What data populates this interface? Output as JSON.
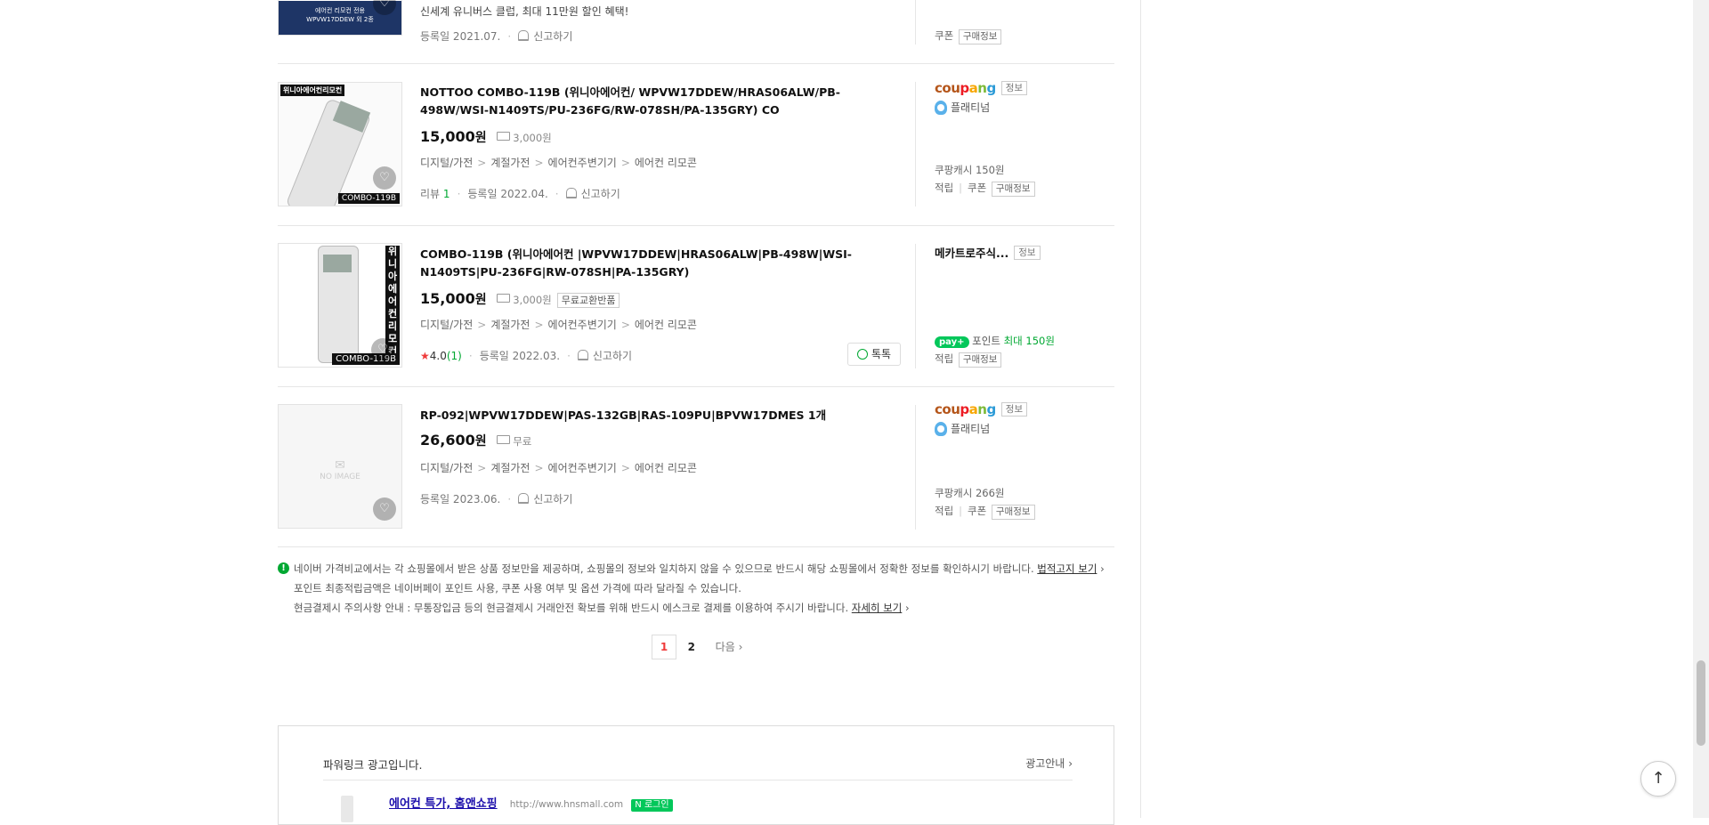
{
  "products": [
    {
      "image_text": [
        "에어컨 리모컨 전용",
        "WPVW17DDEW 외 2종"
      ],
      "promo": "신세계 유니버스 클럽, 최대 11만원 할인 혜택!",
      "reg_date": "등록일 2021.07.",
      "report": "신고하기",
      "seller_line": [
        "쿠폰",
        "구매정보"
      ]
    },
    {
      "image_label": "위니아에어컨리모컨",
      "image_model": "COMBO-119B",
      "title": "NOTTOO COMBO-119B (위니아에어컨/ WPVW17DDEW/HRAS06ALW/PB-498W/WSI-N1409TS/PU-236FG/RW-078SH/PA-135GRY) CO",
      "price": "15,000",
      "won": "원",
      "shipping": "3,000원",
      "categories": [
        "디지털/가전",
        "계절가전",
        "에어컨주변기기",
        "에어컨 리모콘"
      ],
      "review_label": "리뷰",
      "review_count": "1",
      "reg_date": "등록일 2022.04.",
      "report": "신고하기",
      "seller": {
        "logo": [
          "cou",
          "p",
          "a",
          "n",
          "g"
        ],
        "info": "정보",
        "grade": "플래티넘",
        "cash": "쿠팡캐시 150원",
        "tags": [
          "적립",
          "쿠폰"
        ],
        "buy_info": "구매정보"
      }
    },
    {
      "image_label": "위니아에어컨리모컨",
      "image_model": "COMBO-119B",
      "title": "COMBO-119B (위니아에어컨 |WPVW17DDEW|HRAS06ALW|PB-498W|WSI-N1409TS|PU-236FG|RW-078SH|PA-135GRY)",
      "price": "15,000",
      "won": "원",
      "shipping": "3,000원",
      "badge": "무료교환반품",
      "categories": [
        "디지털/가전",
        "계절가전",
        "에어컨주변기기",
        "에어컨 리모콘"
      ],
      "rating": "4.0",
      "rating_count": "(1)",
      "reg_date": "등록일 2022.03.",
      "report": "신고하기",
      "talk": "톡톡",
      "seller": {
        "name": "메카트로주식...",
        "info": "정보",
        "npay": "pay+",
        "point_label": "포인트",
        "point_value": "최대 150원",
        "tags": [
          "적립"
        ],
        "buy_info": "구매정보"
      }
    },
    {
      "image_placeholder": "NO IMAGE",
      "title": "RP-092|WPVW17DDEW|PAS-132GB|RAS-109PU|BPVW17DMES 1개",
      "price": "26,600",
      "won": "원",
      "shipping": "무료",
      "categories": [
        "디지털/가전",
        "계절가전",
        "에어컨주변기기",
        "에어컨 리모콘"
      ],
      "reg_date": "등록일 2023.06.",
      "report": "신고하기",
      "seller": {
        "logo": [
          "cou",
          "p",
          "a",
          "n",
          "g"
        ],
        "info": "정보",
        "grade": "플래티넘",
        "cash": "쿠팡캐시 266원",
        "tags": [
          "적립",
          "쿠폰"
        ],
        "buy_info": "구매정보"
      }
    }
  ],
  "notice": {
    "line1": "네이버 가격비교에서는 각 쇼핑몰에서 받은 상품 정보만을 제공하며, 쇼핑몰의 정보와 일치하지 않을 수 있으므로 반드시 해당 쇼핑몰에서 정확한 정보를 확인하시기 바랍니다.",
    "line1_link": "법적고지 보기",
    "line2": "포인트 최종적립금액은 네이버페이 포인트 사용, 쿠폰 사용 여부 및 옵션 가격에 따라 달라질 수 있습니다.",
    "line3": "현금결제시 주의사항 안내 : 무통장입금 등의 현금결제시 거래안전 확보를 위해 반드시 에스크로 결제를 이용하여 주시기 바랍니다.",
    "line3_link": "자세히 보기"
  },
  "pagination": {
    "current": "1",
    "pages": [
      "2"
    ],
    "next": "다음"
  },
  "powerlink": {
    "title": "파워링크 광고입니다.",
    "guide": "광고안내",
    "ad_title": "에어컨 특가, 홈앤쇼핑",
    "ad_url": "http://www.hnsmall.com",
    "login": "로그인"
  },
  "icons": {
    "top": "arrow-up-icon",
    "heart": "heart-icon",
    "report": "bell-icon"
  },
  "colors": {
    "naver_green": "#03c75a",
    "price_text": "#111111",
    "star": "#ef3a3a"
  }
}
